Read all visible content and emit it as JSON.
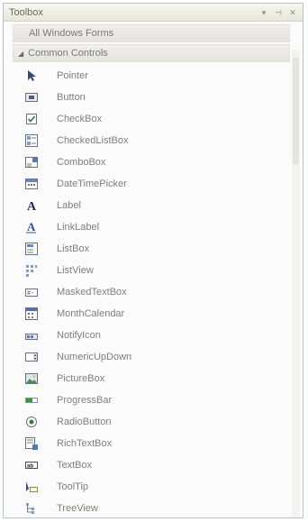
{
  "window": {
    "title": "Toolbox"
  },
  "tabs": {
    "all_windows_forms": "All Windows Forms"
  },
  "group": {
    "label": "Common Controls"
  },
  "items": [
    {
      "label": "Pointer",
      "icon": "pointer-icon"
    },
    {
      "label": "Button",
      "icon": "button-icon"
    },
    {
      "label": "CheckBox",
      "icon": "checkbox-icon"
    },
    {
      "label": "CheckedListBox",
      "icon": "checkedlistbox-icon"
    },
    {
      "label": "ComboBox",
      "icon": "combobox-icon"
    },
    {
      "label": "DateTimePicker",
      "icon": "datetimepicker-icon"
    },
    {
      "label": "Label",
      "icon": "label-icon"
    },
    {
      "label": "LinkLabel",
      "icon": "linklabel-icon"
    },
    {
      "label": "ListBox",
      "icon": "listbox-icon"
    },
    {
      "label": "ListView",
      "icon": "listview-icon"
    },
    {
      "label": "MaskedTextBox",
      "icon": "maskedtextbox-icon"
    },
    {
      "label": "MonthCalendar",
      "icon": "monthcalendar-icon"
    },
    {
      "label": "NotifyIcon",
      "icon": "notifyicon-icon"
    },
    {
      "label": "NumericUpDown",
      "icon": "numericupdown-icon"
    },
    {
      "label": "PictureBox",
      "icon": "picturebox-icon"
    },
    {
      "label": "ProgressBar",
      "icon": "progressbar-icon"
    },
    {
      "label": "RadioButton",
      "icon": "radiobutton-icon"
    },
    {
      "label": "RichTextBox",
      "icon": "richtextbox-icon"
    },
    {
      "label": "TextBox",
      "icon": "textbox-icon"
    },
    {
      "label": "ToolTip",
      "icon": "tooltip-icon"
    },
    {
      "label": "TreeView",
      "icon": "treeview-icon"
    }
  ]
}
